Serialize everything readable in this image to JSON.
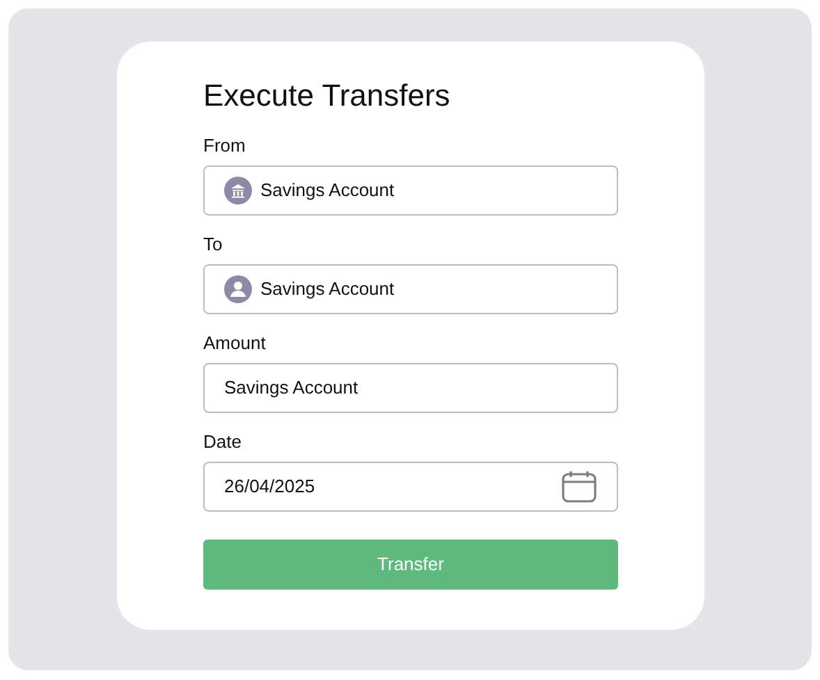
{
  "title": "Execute Transfers",
  "fields": [
    {
      "label": "From",
      "kind": "bank",
      "value": "Savings Account"
    },
    {
      "label": "To",
      "kind": "person",
      "value": "Savings Account"
    },
    {
      "label": "Amount",
      "kind": "text",
      "value": "Savings Account"
    },
    {
      "label": "Date",
      "kind": "date",
      "value": "26/04/2025"
    }
  ],
  "button": "Transfer"
}
